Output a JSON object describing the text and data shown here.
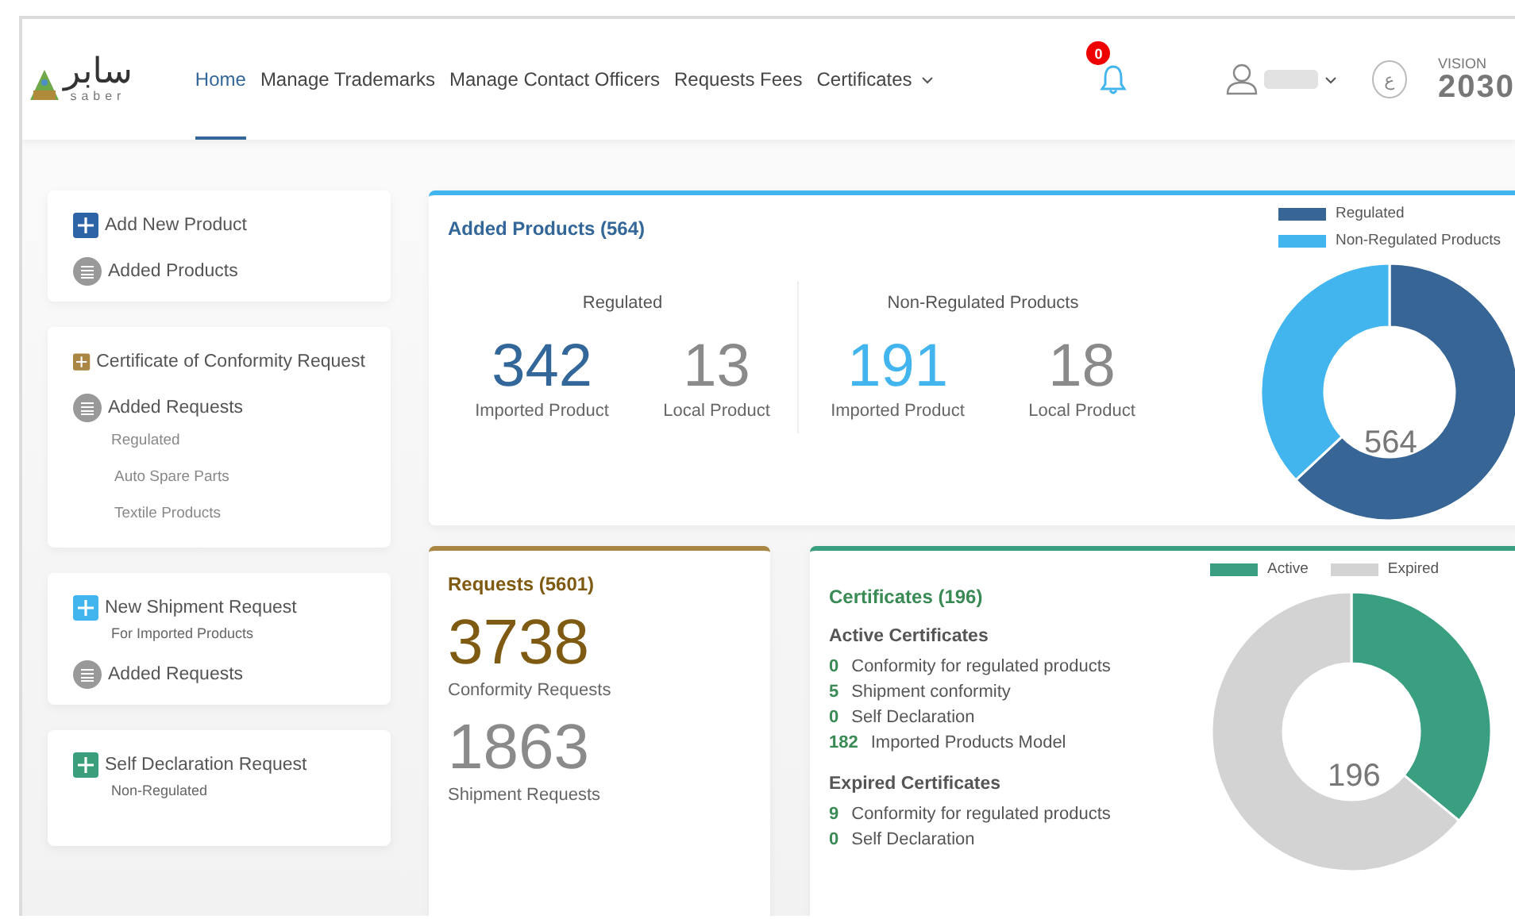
{
  "logo": {
    "arabic": "سابر",
    "latin": "saber"
  },
  "nav": [
    {
      "label": "Home",
      "selected": true,
      "dropdown": false
    },
    {
      "label": "Manage Trademarks",
      "selected": false,
      "dropdown": false
    },
    {
      "label": "Manage Contact Officers",
      "selected": false,
      "dropdown": false
    },
    {
      "label": "Requests Fees",
      "selected": false,
      "dropdown": false
    },
    {
      "label": "Certificates",
      "selected": false,
      "dropdown": true
    }
  ],
  "notifications": {
    "count": "0"
  },
  "language_button": "ع",
  "vision_logo": {
    "vision": "VISION",
    "year": "2030"
  },
  "sidebar": {
    "cards": [
      {
        "items": [
          {
            "kind": "add",
            "label": "Add New Product",
            "color": "#2d64a6"
          },
          {
            "kind": "list",
            "label": "Added Products"
          }
        ]
      },
      {
        "items": [
          {
            "kind": "add",
            "label": "Certificate of Conformity Request",
            "color": "#a98643"
          },
          {
            "kind": "list",
            "label": "Added Requests",
            "sub_items": [
              "Regulated",
              "Auto Spare Parts",
              "Textile Products"
            ]
          }
        ]
      },
      {
        "items": [
          {
            "kind": "add",
            "label": "New Shipment Request",
            "note": "For Imported Products",
            "color": "#42b4ee"
          },
          {
            "kind": "list",
            "label": "Added Requests"
          }
        ]
      },
      {
        "items": [
          {
            "kind": "add",
            "label": "Self Declaration Request",
            "note": "Non-Regulated",
            "color": "#3a9e7a"
          }
        ]
      }
    ]
  },
  "products": {
    "title": "Added Products (564)",
    "groups": [
      {
        "heading": "Regulated",
        "stats": [
          {
            "value": "342",
            "label": "Imported Product",
            "color": "#336699"
          },
          {
            "value": "13",
            "label": "Local Product",
            "color": "#8a8a8a"
          }
        ]
      },
      {
        "heading": "Non-Regulated Products",
        "stats": [
          {
            "value": "191",
            "label": "Imported Product",
            "color": "#42b4ee"
          },
          {
            "value": "18",
            "label": "Local Product",
            "color": "#8a8a8a"
          }
        ]
      }
    ],
    "legend": [
      {
        "label": "Regulated",
        "color": "#376596"
      },
      {
        "label": "Non-Regulated Products",
        "color": "#42b4ee"
      }
    ],
    "center": "564"
  },
  "requests": {
    "title": "Requests (5601)",
    "stats": [
      {
        "value": "3738",
        "label": "Conformity Requests",
        "color": "#7f5a12"
      },
      {
        "value": "1863",
        "label": "Shipment Requests",
        "color": "#8a8a8a"
      }
    ]
  },
  "certificates": {
    "title": "Certificates (196)",
    "sections": [
      {
        "heading": "Active Certificates",
        "rows": [
          {
            "count": "0",
            "label": "Conformity for regulated products"
          },
          {
            "count": "5",
            "label": "Shipment conformity"
          },
          {
            "count": "0",
            "label": "Self Declaration"
          },
          {
            "count": "182",
            "label": "Imported Products Model"
          }
        ]
      },
      {
        "heading": "Expired Certificates",
        "rows": [
          {
            "count": "9",
            "label": "Conformity for regulated products"
          },
          {
            "count": "0",
            "label": "Self Declaration"
          }
        ]
      }
    ],
    "legend": [
      {
        "label": "Active",
        "color": "#3a9e80"
      },
      {
        "label": "Expired",
        "color": "#d3d3d3"
      }
    ],
    "center": "196"
  }
}
